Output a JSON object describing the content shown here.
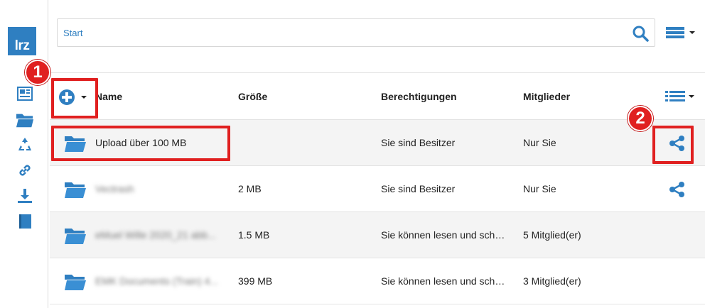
{
  "sidebar": {
    "logo": "lrz",
    "icons": [
      "documents-icon",
      "folder-icon",
      "recycle-icon",
      "link-icon",
      "download-icon",
      "book-icon"
    ]
  },
  "search": {
    "placeholder": "Start"
  },
  "table": {
    "headers": {
      "name": "Name",
      "size": "Größe",
      "permissions": "Berechtigungen",
      "members": "Mitglieder"
    },
    "rows": [
      {
        "name": "Upload über 100 MB",
        "size": "",
        "permissions": "Sie sind Besitzer",
        "members": "Nur Sie",
        "share": true,
        "name_blurred": false
      },
      {
        "name": "Vectrash",
        "size": "2 MB",
        "permissions": "Sie sind Besitzer",
        "members": "Nur Sie",
        "share": true,
        "name_blurred": true
      },
      {
        "name": "eMuel Wille 2020_21 abb...",
        "size": "1.5 MB",
        "permissions": "Sie können lesen und sch…",
        "members": "5 Mitglied(er)",
        "share": false,
        "name_blurred": true
      },
      {
        "name": "EMK Documents (Train) 4...",
        "size": "399 MB",
        "permissions": "Sie können lesen und sch…",
        "members": "3 Mitglied(er)",
        "share": false,
        "name_blurred": true
      }
    ]
  },
  "annotations": [
    {
      "number": "1"
    },
    {
      "number": "2"
    }
  ],
  "colors": {
    "accent": "#2f7fc1",
    "highlight": "#e02020",
    "row_alt": "#f4f4f4"
  }
}
